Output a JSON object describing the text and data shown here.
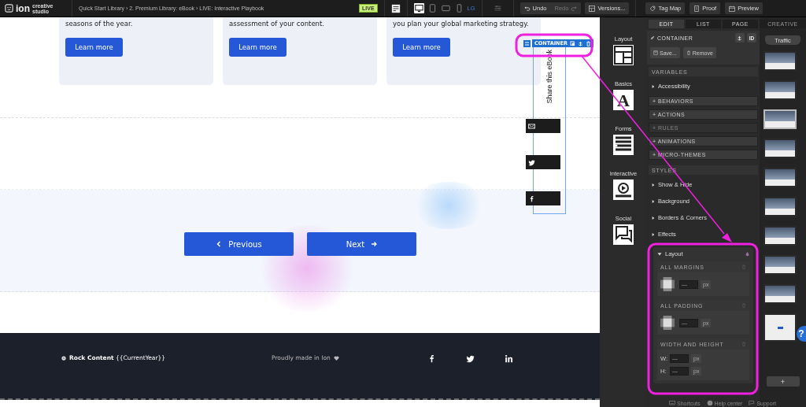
{
  "top_bar": {
    "logo": "ion",
    "product": "creative studio",
    "breadcrumb": "Quick Start Library › 2. Premium Library: eBook › LIVE: Interactive Playbook",
    "status_badge": "LIVE",
    "devices": [
      {
        "kind": "desktop",
        "selected": true
      },
      {
        "kind": "tablet",
        "selected": false
      },
      {
        "kind": "tablet-landscape",
        "selected": false
      },
      {
        "kind": "phone",
        "selected": false
      }
    ],
    "size_label": "LG",
    "history": [
      {
        "kind": "undo",
        "label": "Undo",
        "disabled": false
      },
      {
        "kind": "redo",
        "label": "Redo",
        "disabled": true
      }
    ],
    "versions": "Versions...",
    "actions": [
      {
        "kind": "tag",
        "label": "Tag Map"
      },
      {
        "kind": "proof",
        "label": "Proof"
      },
      {
        "kind": "preview",
        "label": "Preview"
      }
    ]
  },
  "canvas": {
    "cards": [
      {
        "text": "seasons of the year.",
        "button": "Learn more"
      },
      {
        "text": "assessment of your content.",
        "button": "Learn more"
      },
      {
        "text": "you plan your global marketing strategy.",
        "button": "Learn more"
      }
    ],
    "selection": {
      "label": "CONTAINER"
    },
    "share": {
      "label": "Share this eBook",
      "icons": [
        {
          "kind": "email"
        },
        {
          "kind": "twitter"
        },
        {
          "kind": "facebook"
        }
      ]
    },
    "nav": {
      "previous": "Previous",
      "next": "Next"
    },
    "footer": {
      "brand": "**Rock Content** {{CurrentYear}}",
      "made_in": "Proudly made in Ion",
      "social": [
        {
          "kind": "facebook"
        },
        {
          "kind": "twitter"
        },
        {
          "kind": "linkedin"
        }
      ]
    }
  },
  "rail": [
    {
      "kind": "layout",
      "label": "Layout"
    },
    {
      "kind": "basics",
      "label": "Basics",
      "glyph": "A"
    },
    {
      "kind": "forms",
      "label": "Forms"
    },
    {
      "kind": "interactive",
      "label": "Interactive"
    },
    {
      "kind": "social",
      "label": "Social"
    }
  ],
  "panel": {
    "tabs": [
      {
        "label": "EDIT",
        "selected": true
      },
      {
        "label": "LIST",
        "selected": false
      },
      {
        "label": "PAGE",
        "selected": false
      }
    ],
    "element": "CONTAINER",
    "id_button": "ID",
    "save": "Save...",
    "remove": "Remove",
    "sections": [
      {
        "kind": "header",
        "label": "VARIABLES",
        "disabled": false
      },
      {
        "kind": "item",
        "label": "Accessibility",
        "disabled": false
      },
      {
        "kind": "group",
        "label": "+ BEHAVIORS",
        "disabled": false
      },
      {
        "kind": "group",
        "label": "+ ACTIONS",
        "disabled": false
      },
      {
        "kind": "group",
        "label": "+ RULES",
        "disabled": true
      },
      {
        "kind": "group",
        "label": "+ ANIMATIONS",
        "disabled": false
      },
      {
        "kind": "group",
        "label": "+ MICRO-THEMES",
        "disabled": false
      },
      {
        "kind": "header",
        "label": "STYLES",
        "disabled": false
      },
      {
        "kind": "item",
        "label": "Show & Hide",
        "disabled": false
      },
      {
        "kind": "item",
        "label": "Background",
        "disabled": false
      },
      {
        "kind": "item",
        "label": "Borders & Corners",
        "disabled": false
      },
      {
        "kind": "item",
        "label": "Effects",
        "disabled": false
      }
    ],
    "layout": {
      "label": "Layout",
      "expanded": true,
      "groups": [
        {
          "kind": "box",
          "title": "ALL MARGINS",
          "fields": [
            {
              "placeholder": "—",
              "unit": "px"
            }
          ]
        },
        {
          "kind": "box",
          "title": "ALL PADDING",
          "fields": [
            {
              "placeholder": "—",
              "unit": "px"
            }
          ]
        },
        {
          "kind": "size",
          "title": "WIDTH AND HEIGHT",
          "fields": [
            {
              "label": "W:",
              "placeholder": "—",
              "unit": "px"
            },
            {
              "label": "H:",
              "placeholder": "—",
              "unit": "px"
            }
          ]
        }
      ]
    },
    "footer": [
      "Shortcuts",
      "Help center",
      "Support"
    ]
  },
  "creative": {
    "tab": "CREATIVE",
    "filter": "Traffic",
    "thumbnails": [
      {
        "selected": false
      },
      {
        "selected": false
      },
      {
        "selected": true
      },
      {
        "selected": false
      },
      {
        "selected": false
      },
      {
        "selected": false
      },
      {
        "selected": false
      },
      {
        "selected": false
      },
      {
        "selected": false
      },
      {
        "selected": false
      }
    ],
    "add": "+",
    "help": "?"
  }
}
